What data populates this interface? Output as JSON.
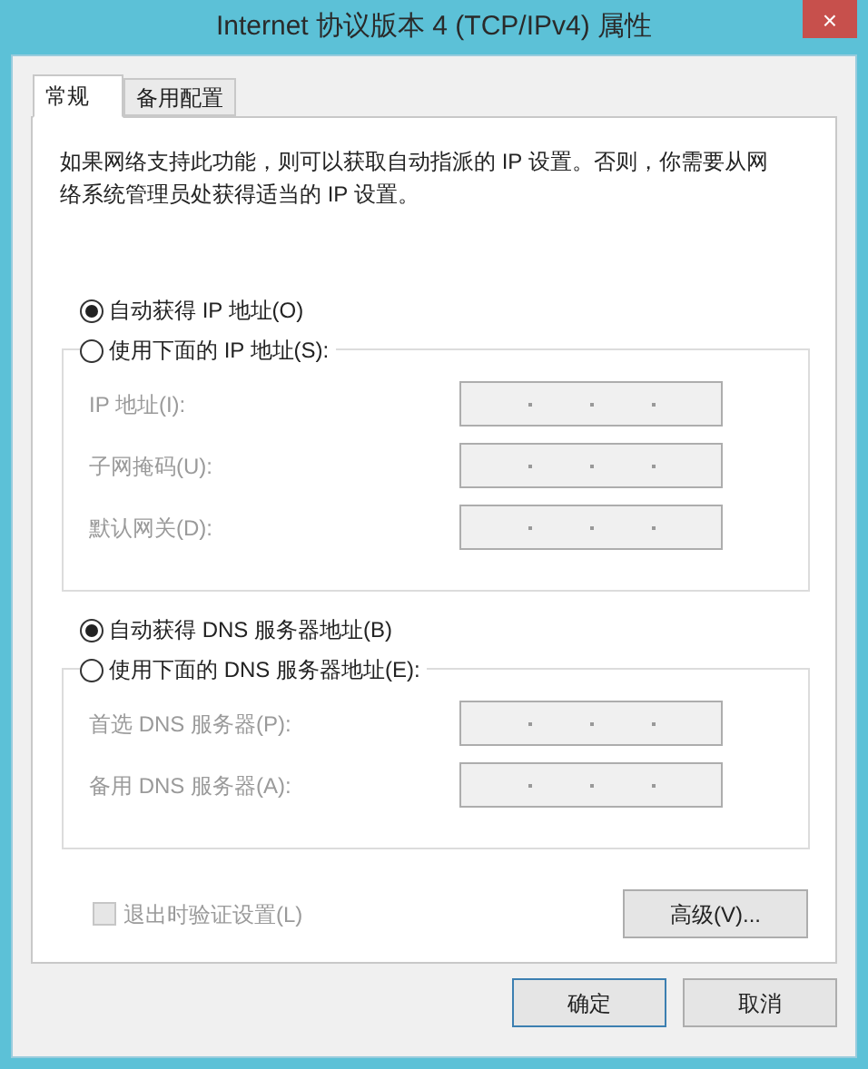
{
  "window": {
    "title": "Internet 协议版本 4 (TCP/IPv4) 属性",
    "close": "×"
  },
  "tabs": [
    {
      "label": "常规",
      "selected": true
    },
    {
      "label": "备用配置",
      "selected": false
    }
  ],
  "description": "如果网络支持此功能，则可以获取自动指派的 IP 设置。否则，你需要从网络系统管理员处获得适当的 IP 设置。",
  "ip_section": {
    "auto_option": {
      "label": "自动获得 IP 地址(O)",
      "selected": true
    },
    "manual_option": {
      "label": "使用下面的 IP 地址(S):",
      "selected": false
    },
    "fields": [
      {
        "label": "IP 地址(I):",
        "disabled": true
      },
      {
        "label": "子网掩码(U):",
        "disabled": true
      },
      {
        "label": "默认网关(D):",
        "disabled": true
      }
    ]
  },
  "dns_section": {
    "auto_option": {
      "label": "自动获得 DNS 服务器地址(B)",
      "selected": true
    },
    "manual_option": {
      "label": "使用下面的 DNS 服务器地址(E):",
      "selected": false
    },
    "fields": [
      {
        "label": "首选 DNS 服务器(P):",
        "disabled": true
      },
      {
        "label": "备用 DNS 服务器(A):",
        "disabled": true
      }
    ]
  },
  "validate_checkbox": {
    "label": "退出时验证设置(L)",
    "checked": false,
    "disabled": true
  },
  "advanced_button": "高级(V)...",
  "buttons": [
    {
      "label": "确定",
      "default": true
    },
    {
      "label": "取消",
      "default": false
    }
  ]
}
